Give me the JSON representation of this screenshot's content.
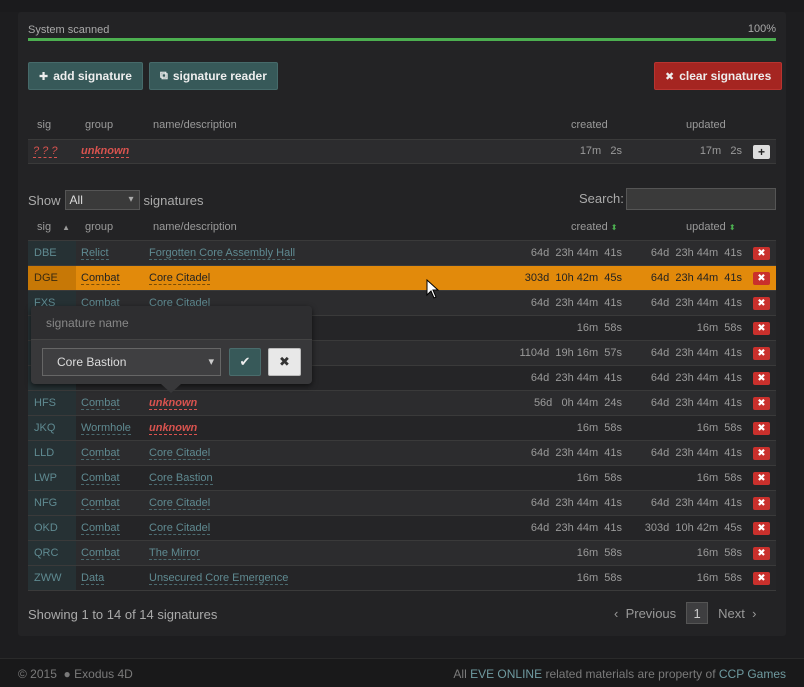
{
  "scan": {
    "label": "System scanned",
    "percent_text": "100%",
    "progress": 1.0
  },
  "toolbar": {
    "add_label": "add signature",
    "reader_label": "signature reader",
    "clear_label": "clear signatures"
  },
  "new_row": {
    "headers": {
      "sig": "sig",
      "group": "group",
      "name": "name/description",
      "created": "created",
      "updated": "updated"
    },
    "sig": "? ? ?",
    "group": "unknown",
    "created": "17m   2s",
    "updated": "17m   2s"
  },
  "filter": {
    "show_label": "Show",
    "show_value": "All",
    "signatures_label": "signatures",
    "search_label": "Search:"
  },
  "table": {
    "headers": {
      "sig": "sig",
      "group": "group",
      "name": "name/description",
      "created": "created",
      "updated": "updated"
    },
    "rows": [
      {
        "sig": "DBE",
        "group": "Relict",
        "name": "Forgotten Core Assembly Hall",
        "created": "64d  23h 44m  41s",
        "updated": "64d  23h 44m  41s"
      },
      {
        "sig": "DGE",
        "group": "Combat",
        "name": "Core Citadel",
        "created": "303d  10h 42m  45s",
        "updated": "64d  23h 44m  41s"
      },
      {
        "sig": "FXS",
        "group": "Combat",
        "name": "Core Citadel",
        "created": "64d  23h 44m  41s",
        "updated": "64d  23h 44m  41s"
      },
      {
        "sig": "",
        "group": "",
        "name": "",
        "created": "16m  58s",
        "updated": "16m  58s"
      },
      {
        "sig": "",
        "group": "",
        "name": "",
        "created": "1104d  19h 16m  57s",
        "updated": "64d  23h 44m  41s"
      },
      {
        "sig": "",
        "group": "",
        "name": "",
        "created": "64d  23h 44m  41s",
        "updated": "64d  23h 44m  41s"
      },
      {
        "sig": "HFS",
        "group": "Combat",
        "name": "unknown",
        "created": "56d   0h 44m  24s",
        "updated": "64d  23h 44m  41s"
      },
      {
        "sig": "JKQ",
        "group": "Wormhole",
        "name": "unknown",
        "created": "16m  58s",
        "updated": "16m  58s"
      },
      {
        "sig": "LLD",
        "group": "Combat",
        "name": "Core Citadel",
        "created": "64d  23h 44m  41s",
        "updated": "64d  23h 44m  41s"
      },
      {
        "sig": "LWP",
        "group": "Combat",
        "name": "Core Bastion",
        "created": "16m  58s",
        "updated": "16m  58s"
      },
      {
        "sig": "NFG",
        "group": "Combat",
        "name": "Core Citadel",
        "created": "64d  23h 44m  41s",
        "updated": "64d  23h 44m  41s"
      },
      {
        "sig": "OKD",
        "group": "Combat",
        "name": "Core Citadel",
        "created": "64d  23h 44m  41s",
        "updated": "303d  10h 42m  45s"
      },
      {
        "sig": "QRC",
        "group": "Combat",
        "name": "The Mirror",
        "created": "16m  58s",
        "updated": "16m  58s"
      },
      {
        "sig": "ZWW",
        "group": "Data",
        "name": "Unsecured Core Emergence",
        "created": "16m  58s",
        "updated": "16m  58s"
      }
    ]
  },
  "popup": {
    "title": "signature name",
    "value": "Core Bastion"
  },
  "footer_table": {
    "info": "Showing 1 to 14 of 14 signatures",
    "prev": "Previous",
    "page": "1",
    "next": "Next"
  },
  "footer": {
    "copyright": "© 2015",
    "brand": "Exodus 4D",
    "legal_prefix": "All ",
    "legal_eve": "EVE ONLINE",
    "legal_mid": " related materials are property of ",
    "legal_ccp": "CCP Games"
  },
  "colors": {
    "accent_teal": "#375959",
    "danger": "#c9302c",
    "selected_row": "#e28a0b",
    "progress": "#4caf50"
  }
}
